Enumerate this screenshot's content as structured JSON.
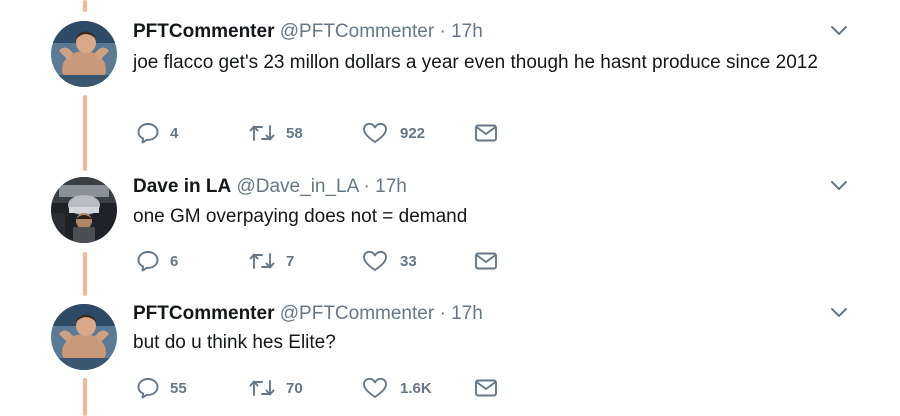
{
  "tweets": [
    {
      "name": "PFTCommenter",
      "handle": "@PFTCommenter",
      "sep": "·",
      "time": "17h",
      "text": "joe flacco get's 23 millon dollars a year even though he hasnt produce since 2012",
      "replies": "4",
      "retweets": "58",
      "likes": "922"
    },
    {
      "name": "Dave in LA",
      "handle": "@Dave_in_LA",
      "sep": "·",
      "time": "17h",
      "text": "one GM overpaying does not = demand",
      "replies": "6",
      "retweets": "7",
      "likes": "33"
    },
    {
      "name": "PFTCommenter",
      "handle": "@PFTCommenter",
      "sep": "·",
      "time": "17h",
      "text": "but do u think hes Elite?",
      "replies": "55",
      "retweets": "70",
      "likes": "1.6K"
    }
  ],
  "icons": {
    "reply": "reply-icon",
    "retweet": "retweet-icon",
    "like": "heart-icon",
    "message": "envelope-icon",
    "caret": "chevron-down-icon"
  },
  "colors": {
    "thread_line": "#f5b896",
    "secondary_text": "#657786",
    "primary_text": "#14171a"
  }
}
